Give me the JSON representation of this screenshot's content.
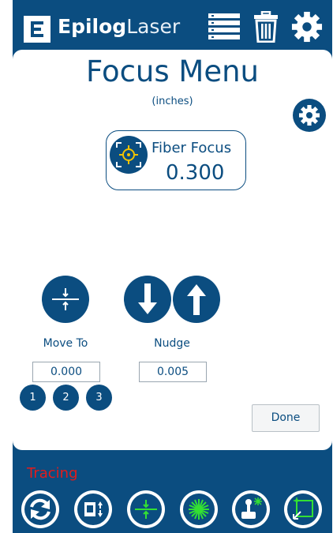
{
  "colors": {
    "brand": "#0b4d80",
    "accent_green": "#33e033",
    "status_red": "#e31b1b"
  },
  "header": {
    "logo_bold": "Epilog",
    "logo_light": "Laser",
    "icons": [
      "job-list-icon",
      "trash-icon",
      "gear-icon"
    ]
  },
  "main": {
    "title": "Focus Menu",
    "subtitle": "(inches)",
    "focus": {
      "label": "Fiber Focus",
      "value": "0.300"
    },
    "move_to": {
      "label": "Move To",
      "value": "0.000"
    },
    "nudge": {
      "label": "Nudge",
      "value": "0.005"
    },
    "presets": [
      "1",
      "2",
      "3"
    ],
    "done_label": "Done"
  },
  "footer": {
    "status": "Tracing",
    "icons": [
      "refresh-icon",
      "job-info-icon",
      "focus-move-icon",
      "laser-icon",
      "joystick-laser-icon",
      "frame-trace-icon"
    ]
  }
}
